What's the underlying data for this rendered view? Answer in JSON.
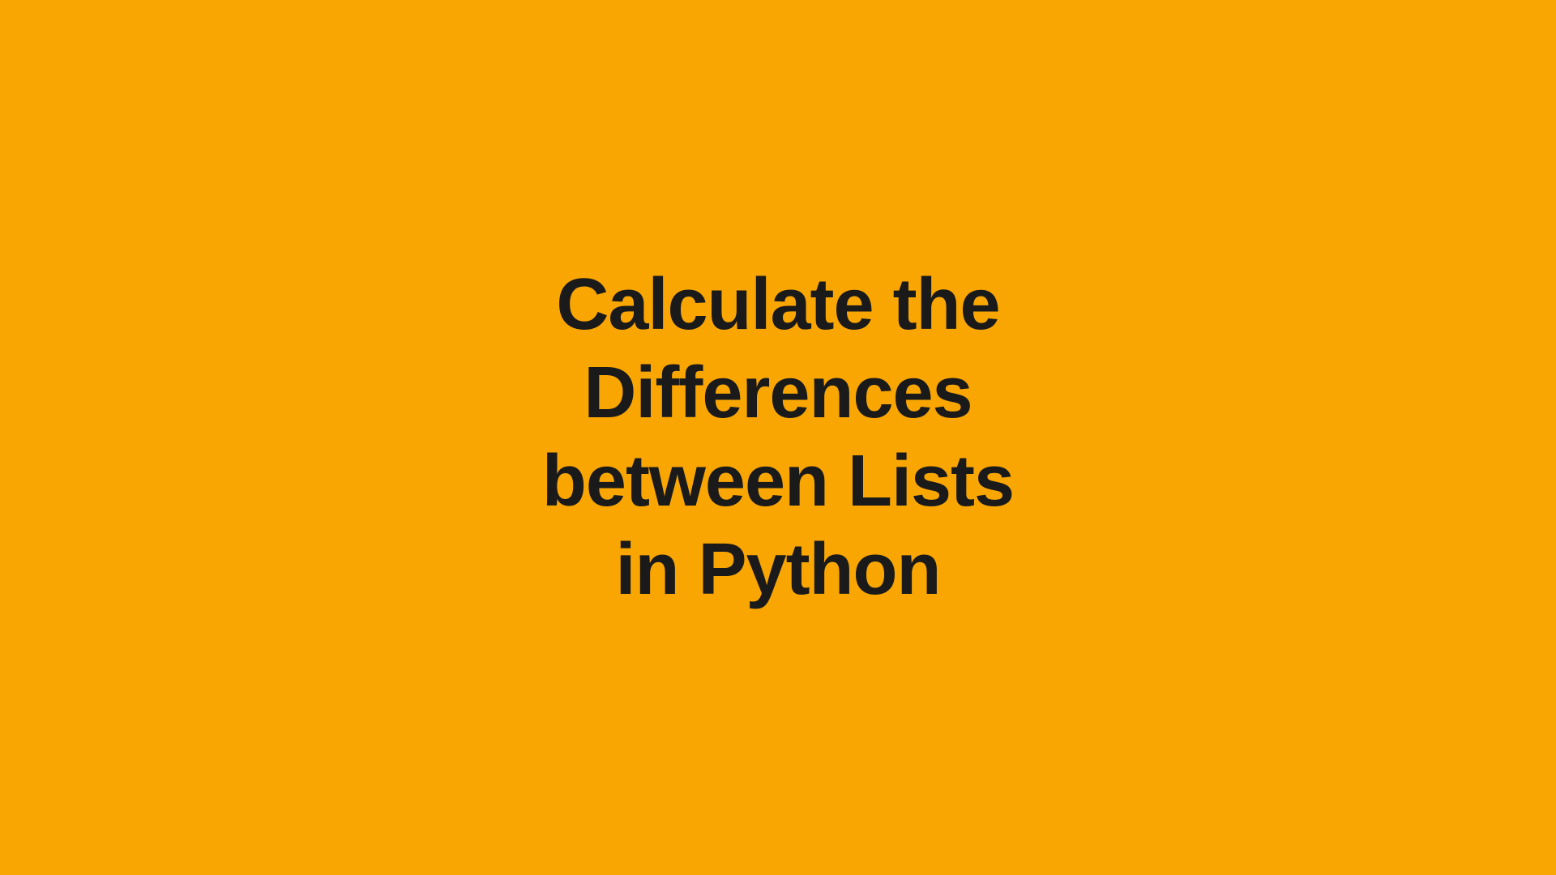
{
  "title": {
    "line1": "Calculate the",
    "line2": "Differences",
    "line3": "between Lists",
    "line4": "in Python"
  },
  "colors": {
    "background": "#F9A602",
    "text": "#1a1a1a"
  }
}
